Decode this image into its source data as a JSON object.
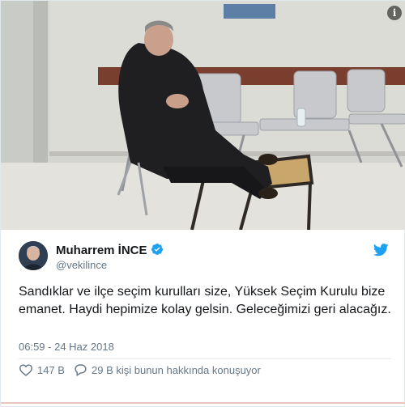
{
  "tweet": {
    "display_name": "Muharrem İNCE",
    "handle": "@vekilince",
    "text": "Sandıklar ve ilçe seçim kurulları size, Yüksek Seçim Kurulu bize emanet. Haydi hepimize kolay gelsin. Geleceğimizi geri alacağız.",
    "timestamp": "06:59 - 24 Haz 2018",
    "likes": "147 B",
    "replies_text": "29 B kişi bunun hakkında konuşuyor",
    "verified": true
  },
  "photo": {
    "info_badge": "i"
  },
  "icons": [
    "info-icon",
    "verified-icon",
    "twitter-bird-icon",
    "heart-icon",
    "comment-icon"
  ],
  "colors": {
    "twitter_blue": "#1da1f2",
    "text_primary": "#14171a",
    "text_secondary": "#657786",
    "divider": "#e6ecf0"
  }
}
